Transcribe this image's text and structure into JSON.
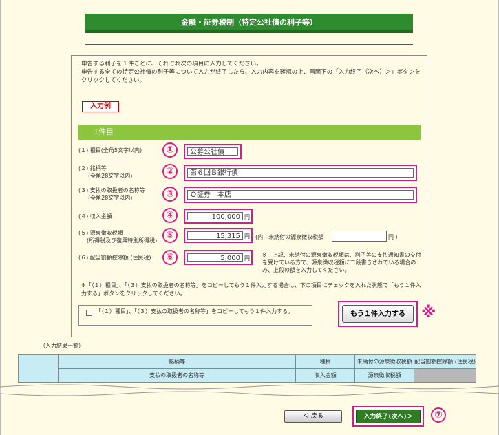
{
  "page": {
    "title": "金融・証券税制（特定公社債の利子等）"
  },
  "intro": {
    "line1": "申告する利子を１件ごとに、それぞれ次の項目に入力してください。",
    "line2": "申告する全ての特定公社債の利子等について入力が終了したら、入力内容を確認の上、画面下の「入力終了（次へ）＞」ボタンをクリックしてください。"
  },
  "example_button": "入力例",
  "section": {
    "heading": "1件目"
  },
  "fields": {
    "f1": {
      "label1": "(１) 種目(全角5文字以内)",
      "value": "公募公社債",
      "marker": "①"
    },
    "f2": {
      "label1": "(２) 銘柄等",
      "label2": "(全角28文字以内)",
      "value": "第６回Ｂ銀行債",
      "marker": "②"
    },
    "f3": {
      "label1": "(３) 支払の取扱者の名称等",
      "label2": "(全角28文字以内)",
      "value": "Ｏ証券　本店",
      "marker": "③"
    },
    "f4": {
      "label1": "(４) 収入金額",
      "value": "100,000",
      "unit": "円",
      "marker": "④"
    },
    "f5": {
      "label1": "(５) 源泉徴収税額",
      "label2": "(所得税及び復興特別所得税)",
      "value": "15,315",
      "unit": "円",
      "marker": "⑤",
      "extra_prefix": "(内　未納付の源泉徴収税額",
      "extra_suffix": "円 ）",
      "extra_value": ""
    },
    "f6": {
      "label1": "(６) 配当割額控除額 (住民税)",
      "value": "5,000",
      "unit": "円",
      "marker": "⑥",
      "note": "※　上記、未納付の源泉徴収税額は、利子等の支払通知書の交付を受けている方で、源泉徴収税額に二段書きされている場合のみ、上段の額を入力してください。"
    }
  },
  "copy": {
    "note": "※「（１）種目」、「（３）支払の取扱者の名称等」をコピーしてもう１件入力する場合は、下の項目にチェックを入れた状態で「もう１件入力する」ボタンをクリックしてください。",
    "checkbox_label": "「（１）種目」、「（３）支払の取扱者の名称等」をコピーしてもう１件入力する。",
    "checked": false,
    "more_button": "もう１件入力する",
    "kome_marker": "※"
  },
  "results": {
    "caption": "（入力結果一覧）",
    "h_brand": "銘柄等",
    "h_kind": "種目",
    "h_unpaid": "未納付の源泉徴収税額",
    "h_deduct": "配当割額控除額 (住民税)",
    "h_payer": "支払の取扱者の名称等",
    "h_income": "収入金額",
    "h_withhold": "源泉徴収税額"
  },
  "nav": {
    "back": "＜ 戻る",
    "finish": "入力終了(次へ)＞",
    "finish_marker": "⑦"
  },
  "colors": {
    "accent": "#d81b8c",
    "title_green": "#2e8b2e",
    "section_green": "#8cc63f",
    "background": "#fffbe4"
  }
}
